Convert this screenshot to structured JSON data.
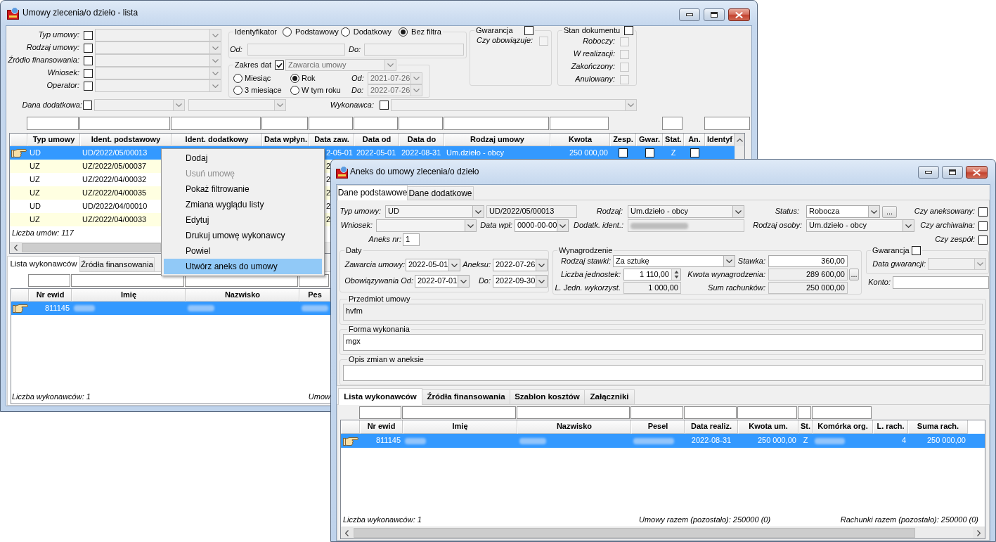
{
  "list_window": {
    "title": "Umowy zlecenia/o dzieło - lista",
    "filters": [
      {
        "label": "Typ umowy:",
        "checked": false
      },
      {
        "label": "Rodzaj umowy:",
        "checked": false
      },
      {
        "label": "Źródło finansowania:",
        "checked": false
      },
      {
        "label": "Wniosek:",
        "checked": false
      },
      {
        "label": "Operator:",
        "checked": false
      }
    ],
    "identyfikator": {
      "title": "Identyfikator",
      "options": [
        {
          "label": "Podstawowy",
          "selected": false
        },
        {
          "label": "Dodatkowy",
          "selected": false
        },
        {
          "label": "Bez filtra",
          "selected": true
        }
      ],
      "from_label": "Od:",
      "to_label": "Do:"
    },
    "zakres_dat": {
      "title": "Zakres dat",
      "checked": true,
      "date_type": "Zawarcia umowy",
      "periods": [
        {
          "label": "Miesiąc",
          "selected": false
        },
        {
          "label": "Rok",
          "selected": true
        },
        {
          "label": "3 miesiące",
          "selected": false
        },
        {
          "label": "W tym roku",
          "selected": false
        }
      ],
      "from_label": "Od:",
      "from_value": "2021-07-26",
      "to_label": "Do:",
      "to_value": "2022-07-26"
    },
    "gwarancja": {
      "title": "Gwarancja",
      "checked": false,
      "items": [
        {
          "label": "Czy obowiązuje:",
          "checked": false,
          "disabled": true
        }
      ]
    },
    "stan_dokumentu": {
      "title": "Stan dokumentu",
      "checked": false,
      "items": [
        {
          "label": "Roboczy:",
          "checked": false,
          "disabled": true
        },
        {
          "label": "W realizacji:",
          "checked": false,
          "disabled": true
        },
        {
          "label": "Zakończony:",
          "checked": false,
          "disabled": true
        },
        {
          "label": "Anulowany:",
          "checked": false,
          "disabled": true
        }
      ]
    },
    "dana_dodatkowa": {
      "label": "Dana dodatkowa:",
      "checked": false
    },
    "wykonawca": {
      "label": "Wykonawca:",
      "checked": false
    },
    "contracts": {
      "columns": [
        "Typ umowy",
        "Ident. podstawowy",
        "Ident. dodatkowy",
        "Data wpłyn.",
        "Data zaw.",
        "Data od",
        "Data do",
        "Rodzaj umowy",
        "Kwota",
        "Zesp.",
        "Gwar.",
        "Stat.",
        "An.",
        "Identyf"
      ],
      "rows": [
        {
          "selected": true,
          "typ_umowy": "UD",
          "ident_podstawowy": "UD/2022/05/00013",
          "data_zawarcia": "2-05-01",
          "data_od": "2022-05-01",
          "data_do": "2022-08-31",
          "rodzaj_umowy": "Um.dzieło - obcy",
          "kwota": "250 000,00",
          "zespol": {
            "checked": false
          },
          "gwarancja": {
            "checked": false
          },
          "status": "Z",
          "aneks": {
            "checked": false
          }
        },
        {
          "selected": false,
          "typ_umowy": "UZ",
          "ident_podstawowy": "UZ/2022/05/00037",
          "data_zawarcia": "2"
        },
        {
          "selected": false,
          "typ_umowy": "UZ",
          "ident_podstawowy": "UZ/2022/04/00032",
          "data_zawarcia": "2"
        },
        {
          "selected": false,
          "typ_umowy": "UZ",
          "ident_podstawowy": "UZ/2022/04/00035",
          "data_zawarcia": "2"
        },
        {
          "selected": false,
          "typ_umowy": "UD",
          "ident_podstawowy": "UD/2022/04/00010",
          "data_zawarcia": "2"
        },
        {
          "selected": false,
          "typ_umowy": "UZ",
          "ident_podstawowy": "UZ/2022/04/00033",
          "data_zawarcia": "2"
        }
      ],
      "count": "Liczba umów: 117"
    },
    "tabs": [
      {
        "label": "Lista wykonawców",
        "selected": true
      },
      {
        "label": "Źródła finansowania",
        "selected": false
      }
    ],
    "contractors": {
      "columns": [
        "Nr ewid",
        "Imię",
        "Nazwisko",
        "Pes"
      ],
      "rows": [
        {
          "selected": true,
          "nr_ewid": "811145",
          "imie": {
            "redacted": true
          },
          "nazwisko": {
            "redacted": true
          },
          "pesel": {
            "redacted": true
          }
        }
      ],
      "count": "Liczba wykonawców: 1",
      "totals": "Umow"
    }
  },
  "context_menu": {
    "items": [
      {
        "label": "Dodaj",
        "disabled": false,
        "highlighted": false
      },
      {
        "label": "Usuń umowę",
        "disabled": true,
        "highlighted": false
      },
      {
        "label": "Pokaż filtrowanie",
        "disabled": false,
        "highlighted": false
      },
      {
        "label": "Zmiana wyglądu listy",
        "disabled": false,
        "highlighted": false
      },
      {
        "label": "Edytuj",
        "disabled": false,
        "highlighted": false
      },
      {
        "label": "Drukuj umowę wykonawcy",
        "disabled": false,
        "highlighted": false
      },
      {
        "label": "Powiel",
        "disabled": false,
        "highlighted": false
      },
      {
        "label": "Utwórz aneks do umowy",
        "disabled": false,
        "highlighted": true
      }
    ]
  },
  "annex_window": {
    "title": "Aneks do umowy zlecenia/o dzieło",
    "tabs": [
      {
        "label": "Dane podstawowe",
        "selected": true
      },
      {
        "label": "Dane dodatkowe",
        "selected": false
      }
    ],
    "typ_umowy": {
      "label": "Typ umowy:",
      "value": "UD",
      "readonly": true
    },
    "ident": {
      "value": "UD/2022/05/00013",
      "readonly": true
    },
    "rodzaj": {
      "label": "Rodzaj:",
      "value": "Um.dzieło - obcy",
      "readonly": true
    },
    "status": {
      "label": "Status:",
      "value": "Robocza",
      "readonly": false,
      "more": "..."
    },
    "wniosek": {
      "label": "Wniosek:",
      "readonly": true
    },
    "data_wplywu": {
      "label": "Data wpł:",
      "value": "0000-00-00",
      "readonly": false
    },
    "dodatkowy_ident": {
      "label": "Dodatk. ident.:",
      "readonly": true,
      "redacted": true
    },
    "rodzaj_osoby": {
      "label": "Rodzaj osoby:",
      "value": "Um.dzieło - obcy",
      "readonly": true
    },
    "aneks_nr": {
      "label": "Aneks nr:",
      "value": "1",
      "readonly": false
    },
    "flags": [
      {
        "label": "Czy aneksowany:",
        "checked": false
      },
      {
        "label": "Czy archiwalna:",
        "checked": false
      },
      {
        "label": "Czy zespół:",
        "checked": false
      }
    ],
    "daty": {
      "title": "Daty",
      "fields": [
        {
          "label": "Zawarcia umowy:",
          "value": "2022-05-01",
          "readonly": false
        },
        {
          "label": "Aneksu:",
          "value": "2022-07-26",
          "readonly": false
        },
        {
          "label": "Obowiązywania Od:",
          "value": "2022-07-01",
          "readonly": false
        },
        {
          "label": "Do:",
          "value": "2022-09-30",
          "readonly": false
        }
      ]
    },
    "wynagrodzenie": {
      "title": "Wynagrodzenie",
      "rodzaj_stawki": {
        "label": "Rodzaj stawki:",
        "value": "Za sztukę",
        "readonly": false
      },
      "stawka": {
        "label": "Stawka:",
        "value": "360,00",
        "readonly": false
      },
      "liczba_jednostek": {
        "label": "Liczba jednostek:",
        "value": "1 110,00",
        "readonly": false
      },
      "kwota": {
        "label": "Kwota wynagrodzenia:",
        "value": "289 600,00",
        "readonly": true,
        "more": "..."
      },
      "jednostki_wykorzystane": {
        "label": "L. Jedn. wykorzyst.",
        "value": "1 000,00",
        "readonly": true
      },
      "suma_rachunkow": {
        "label": "Sum rachunków:",
        "value": "250 000,00",
        "readonly": true
      }
    },
    "gwarancja": {
      "title": "Gwarancja",
      "checked": false,
      "date_label": "Data gwarancji:"
    },
    "konto": {
      "label": "Konto:",
      "readonly": false
    },
    "przedmiot": {
      "title": "Przedmiot umowy",
      "value": "hvfm",
      "readonly": true
    },
    "forma": {
      "title": "Forma wykonania",
      "value": "mgx",
      "readonly": false
    },
    "opis": {
      "title": "Opis zmian w aneksie",
      "readonly": false
    },
    "lower_tabs": [
      {
        "label": "Lista wykonawców",
        "selected": true
      },
      {
        "label": "Źródła finansowania",
        "selected": false
      },
      {
        "label": "Szablon kosztów",
        "selected": false
      },
      {
        "label": "Załączniki",
        "selected": false
      }
    ],
    "contractors": {
      "columns": [
        "Nr ewid",
        "Imię",
        "Nazwisko",
        "Pesel",
        "Data realiz.",
        "Kwota um.",
        "St.",
        "Komórka org.",
        "L. rach.",
        "Suma rach."
      ],
      "rows": [
        {
          "selected": true,
          "nr_ewid": "811145",
          "imie": {
            "redacted": true
          },
          "nazwisko": {
            "redacted": true
          },
          "pesel": {
            "redacted": true
          },
          "data_realizacji": "2022-08-31",
          "kwota": "250 000,00",
          "st": "Z",
          "komorka": {
            "redacted": true
          },
          "l_rach": "4",
          "suma": "250 000,00"
        }
      ],
      "count": "Liczba wykonawców: 1",
      "contracts_total": "Umowy razem (pozostało): 250000 (0)",
      "bills_total": "Rachunki razem (pozostało): 250000 (0)"
    }
  }
}
